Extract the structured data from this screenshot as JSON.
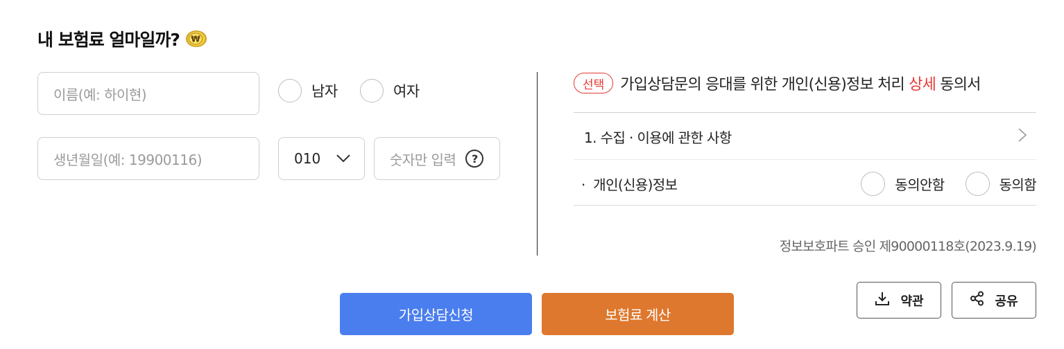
{
  "header": {
    "title": "내 보험료 얼마일까?",
    "title_icon": "won-coin-icon"
  },
  "form": {
    "name_placeholder": "이름(예: 하이현)",
    "gender_male": "남자",
    "gender_female": "여자",
    "birth_placeholder": "생년월일(예: 19900116)",
    "phone_prefix": "010",
    "phone_placeholder": "숫자만 입력"
  },
  "consent": {
    "badge": "선택",
    "title_prefix": "가입상담문의 응대를 위한 개인(신용)정보 처리 ",
    "title_highlight": "상세",
    "title_suffix": " 동의서",
    "item1": "1. 수집 · 이용에 관한 사항",
    "info_label": "개인(신용)정보",
    "disagree": "동의안함",
    "agree": "동의함",
    "approval": "정보보호파트 승인 제90000118호(2023.9.19)"
  },
  "actions": {
    "consult": "가입상담신청",
    "calculate": "보험료 계산",
    "terms": "약관",
    "share": "공유"
  },
  "colors": {
    "primary_blue": "#4a7eee",
    "primary_orange": "#de782e",
    "accent_red": "#e53935"
  }
}
